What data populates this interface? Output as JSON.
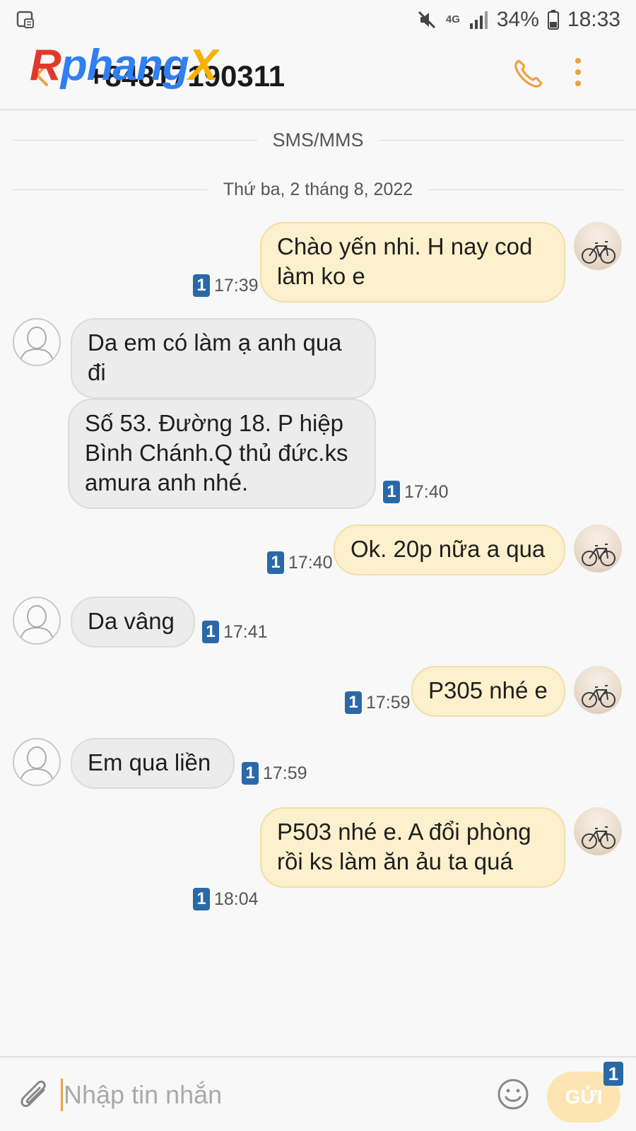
{
  "status_bar": {
    "network": "4G",
    "battery": "34%",
    "time": "18:33",
    "icons": [
      "sim-card-icon",
      "mute-icon",
      "signal-icon",
      "battery-icon"
    ]
  },
  "header": {
    "watermark_r": "R",
    "watermark_p": "phang",
    "watermark_x": "X",
    "phone_number": "+84817190311"
  },
  "separators": {
    "channel": "SMS/MMS",
    "date": "Thứ ba, 2 tháng 8, 2022"
  },
  "messages": [
    {
      "direction": "out",
      "text": "Chào yến nhi. H nay cod làm ko e",
      "time": "17:39",
      "sim": "1"
    },
    {
      "direction": "in",
      "text": "Da em có làm ạ anh qua đi",
      "time": "",
      "sim": ""
    },
    {
      "direction": "in",
      "text": "Số 53. Đường 18. P hiệp Bình Chánh.Q thủ đức.ks amura anh nhé.",
      "time": "17:40",
      "sim": "1"
    },
    {
      "direction": "out",
      "text": "Ok. 20p nữa a qua",
      "time": "17:40",
      "sim": "1"
    },
    {
      "direction": "in",
      "text": "Da vâng",
      "time": "17:41",
      "sim": "1"
    },
    {
      "direction": "out",
      "text": "P305 nhé e",
      "time": "17:59",
      "sim": "1"
    },
    {
      "direction": "in",
      "text": "Em qua liền",
      "time": "17:59",
      "sim": "1"
    },
    {
      "direction": "out",
      "text": "P503  nhé e. A đổi phòng rồi ks làm ăn ảu ta quá",
      "time": "18:04",
      "sim": "1"
    }
  ],
  "composer": {
    "placeholder": "Nhập tin nhắn",
    "send_label": "GỬI",
    "sim_badge": "1"
  },
  "colors": {
    "accent": "#f0a03c",
    "outgoing_bubble": "#fdf0cc",
    "incoming_bubble": "#ececec",
    "sim_badge": "#2a69a8"
  }
}
